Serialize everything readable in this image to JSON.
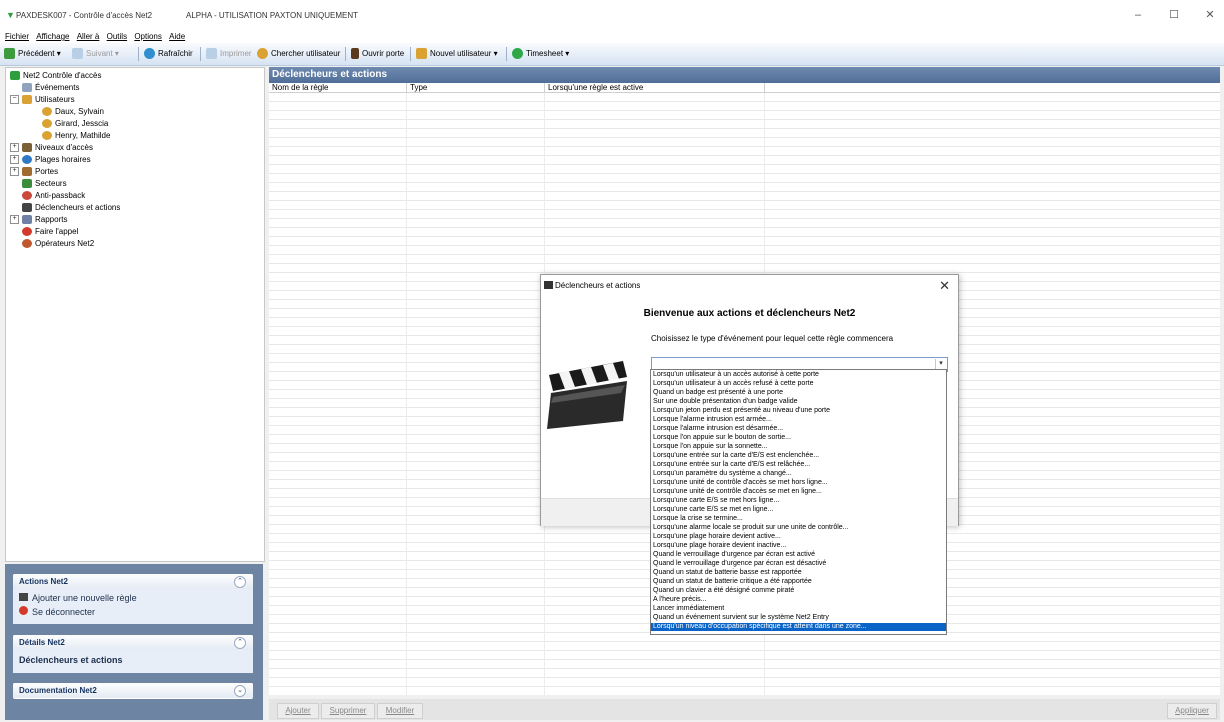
{
  "window": {
    "title": "PAXDESK007 - Contrôle d'accès Net2",
    "subtitle": "ALPHA - UTILISATION PAXTON UNIQUEMENT",
    "controls": [
      "–",
      "☐",
      "✕"
    ]
  },
  "menu": [
    "Fichier",
    "Affichage",
    "Aller à",
    "Outils",
    "Options",
    "Aide"
  ],
  "toolbar": {
    "back": "Précédent ▾",
    "forward": "Suivant ▾",
    "refresh": "Rafraîchir",
    "print": "Imprimer",
    "find_user": "Chercher utilisateur",
    "open_door": "Ouvrir porte",
    "new_user": "Nouvel utilisateur ▾",
    "timesheet": "Timesheet ▾"
  },
  "tree": [
    {
      "label": "Net2 Contrôle d'accès",
      "expander": "",
      "icon": "#2e9e3c"
    },
    {
      "label": "Événements",
      "expander": "",
      "icon": "#8fa3bf"
    },
    {
      "label": "Utilisateurs",
      "expander": "⊟",
      "icon": "#d9a233"
    },
    {
      "label": "Daux, Sylvain",
      "expander": "",
      "icon": "#d9a233"
    },
    {
      "label": "Girard, Jesscia",
      "expander": "",
      "icon": "#d9a233"
    },
    {
      "label": "Henry, Mathilde",
      "expander": "",
      "icon": "#d9a233"
    },
    {
      "label": "Niveaux d'accès",
      "expander": "⊞",
      "icon": "#7b5f36"
    },
    {
      "label": "Plages horaires",
      "expander": "⊞",
      "icon": "#2f78c4"
    },
    {
      "label": "Portes",
      "expander": "⊞",
      "icon": "#a26b32"
    },
    {
      "label": "Secteurs",
      "expander": "",
      "icon": "#3a8d3a"
    },
    {
      "label": "Anti-passback",
      "expander": "",
      "icon": "#c94a3a"
    },
    {
      "label": "Déclencheurs et actions",
      "expander": "",
      "icon": "#444444"
    },
    {
      "label": "Rapports",
      "expander": "⊞",
      "icon": "#6f7fa5"
    },
    {
      "label": "Faire l'appel",
      "expander": "",
      "icon": "#d33a2c"
    },
    {
      "label": "Opérateurs Net2",
      "expander": "",
      "icon": "#c0572f"
    }
  ],
  "panels": {
    "actions": {
      "title": "Actions Net2",
      "items": [
        "Ajouter une nouvelle règle",
        "Se déconnecter"
      ]
    },
    "details": {
      "title": "Détails Net2",
      "value": "Déclencheurs et actions"
    },
    "docs": {
      "title": "Documentation Net2"
    }
  },
  "main": {
    "header": "Déclencheurs et actions",
    "columns": [
      "Nom de la règle",
      "Type",
      "Lorsqu'une règle est active"
    ]
  },
  "bottom": {
    "add": "Ajouter",
    "delete": "Supprimer",
    "edit": "Modifier",
    "apply": "Appliquer"
  },
  "dialog": {
    "title": "Déclencheurs et actions",
    "heading": "Bienvenue aux actions et déclencheurs Net2",
    "prompt": "Choisissez le type d'événement pour lequel cette règle commencera",
    "selected_value": "",
    "options": [
      "Lorsqu'un utilisateur à un accès autorisé à cette porte",
      "Lorsqu'un utilisateur à un accès refusé à cette porte",
      "Quand un badge est présenté à une porte",
      "Sur une double présentation d'un badge valide",
      "Lorsqu'un jeton perdu est présenté au niveau d'une porte",
      "Lorsque l'alarme intrusion est armée...",
      "Lorsque l'alarme intrusion est désarmée...",
      "Lorsque l'on appuie sur le bouton de sortie...",
      "Lorsque l'on appuie sur la sonnette...",
      "Lorsqu'une entrée sur la carte d'E/S est enclenchée...",
      "Lorsqu'une entrée sur la carte d'E/S est relâchée...",
      "Lorsqu'un paramètre du système a changé...",
      "Lorsqu'une unité de contrôle d'accès se met hors ligne...",
      "Lorsqu'une unité de contrôle d'accès se met en ligne...",
      "Lorsqu'une carte E/S se met hors ligne...",
      "Lorsqu'une carte E/S se met en ligne...",
      "Lorsque la crise se termine...",
      "Lorsqu'une alarme locale se produit sur une unite de contrôle...",
      "Lorsqu'une plage horaire devient active...",
      "Lorsqu'une plage horaire devient inactive...",
      "Quand le verrouillage d'urgence par écran est activé",
      "Quand le verrouillage d'urgence par écran est désactivé",
      "Quand un statut de batterie basse est rapportée",
      "Quand un statut de batterie critique a été rapportée",
      "Quand un clavier a été désigné comme piraté",
      "A l'heure précis...",
      "Lancer immédiatement",
      "Quand un événement survient sur le système Net2 Entry",
      "Lorsqu'un niveau d'occupation spécifique est atteint dans une zone..."
    ],
    "selected_index": 28
  }
}
